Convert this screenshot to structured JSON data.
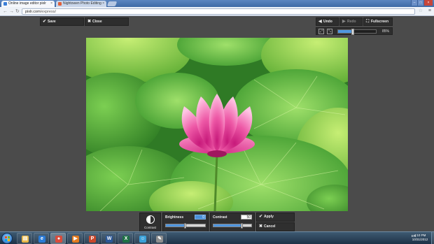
{
  "browser": {
    "tabs": [
      {
        "title": "Online image editor pixlr"
      },
      {
        "title": "Nightowen Photo Editing"
      }
    ],
    "address": {
      "host": "pixlr.com",
      "path": "/express/"
    }
  },
  "editor": {
    "save_label": "Save",
    "close_label": "Close",
    "undo_label": "Undo",
    "redo_label": "Redo",
    "fullscreen_label": "Fullscreen",
    "zoom_percent": "85%",
    "zoom_level": 0.38
  },
  "adjust": {
    "tool_caption": "Contrast",
    "brightness": {
      "label": "Brightness",
      "value": "0",
      "level": 0.5
    },
    "contrast": {
      "label": "Contrast",
      "value": "50",
      "level": 0.75
    },
    "apply_label": "Apply",
    "cancel_label": "Cancel"
  },
  "taskbar": {
    "apps": [
      {
        "icon": "explorer-icon"
      },
      {
        "icon": "internet-explorer-icon"
      },
      {
        "icon": "chrome-icon"
      },
      {
        "icon": "media-player-icon"
      },
      {
        "icon": "powerpoint-icon"
      },
      {
        "icon": "word-icon"
      },
      {
        "icon": "excel-icon"
      },
      {
        "icon": "messenger-icon"
      },
      {
        "icon": "paint-icon"
      }
    ],
    "tray_lang": "EN",
    "time": "4:10 PM",
    "date": "10/31/2012"
  },
  "colors": {
    "accent": "#4e96e0",
    "panel": "#2f2f2f",
    "workspace": "#4b4b4b"
  }
}
